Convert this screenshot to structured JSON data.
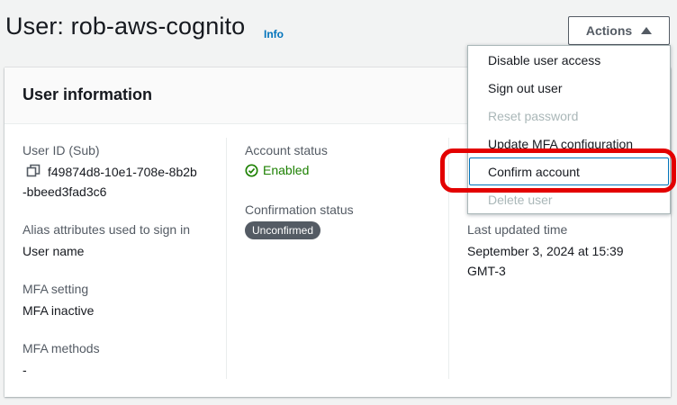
{
  "header": {
    "title": "User: rob-aws-cognito",
    "info_link": "Info",
    "actions_label": "Actions"
  },
  "card": {
    "title": "User information",
    "col1": {
      "user_id_label": "User ID (Sub)",
      "user_id_line1": "f49874d8-10e1-708e-8b2b",
      "user_id_line2": "-bbeed3fad3c6",
      "alias_label": "Alias attributes used to sign in",
      "alias_value": "User name",
      "mfa_setting_label": "MFA setting",
      "mfa_setting_value": "MFA inactive",
      "mfa_methods_label": "MFA methods",
      "mfa_methods_value": "-"
    },
    "col2": {
      "account_status_label": "Account status",
      "account_status_value": "Enabled",
      "confirmation_label": "Confirmation status",
      "confirmation_value": "Unconfirmed"
    },
    "col3": {
      "last_updated_label": "Last updated time",
      "last_updated_line1": "September 3, 2024 at 15:39",
      "last_updated_line2": "GMT-3"
    }
  },
  "dropdown": {
    "items": [
      {
        "label": "Disable user access",
        "disabled": false
      },
      {
        "label": "Sign out user",
        "disabled": false
      },
      {
        "label": "Reset password",
        "disabled": true
      },
      {
        "label": "Update MFA configuration",
        "disabled": false
      },
      {
        "label": "Confirm account",
        "disabled": false,
        "focused": true
      },
      {
        "label": "Delete user",
        "disabled": true
      }
    ]
  },
  "colors": {
    "link": "#0073bb",
    "success": "#1d8102",
    "badge": "#545b64",
    "highlight": "#e30000"
  },
  "icons": [
    "copy-icon",
    "status-check-icon",
    "caret-up-icon"
  ]
}
